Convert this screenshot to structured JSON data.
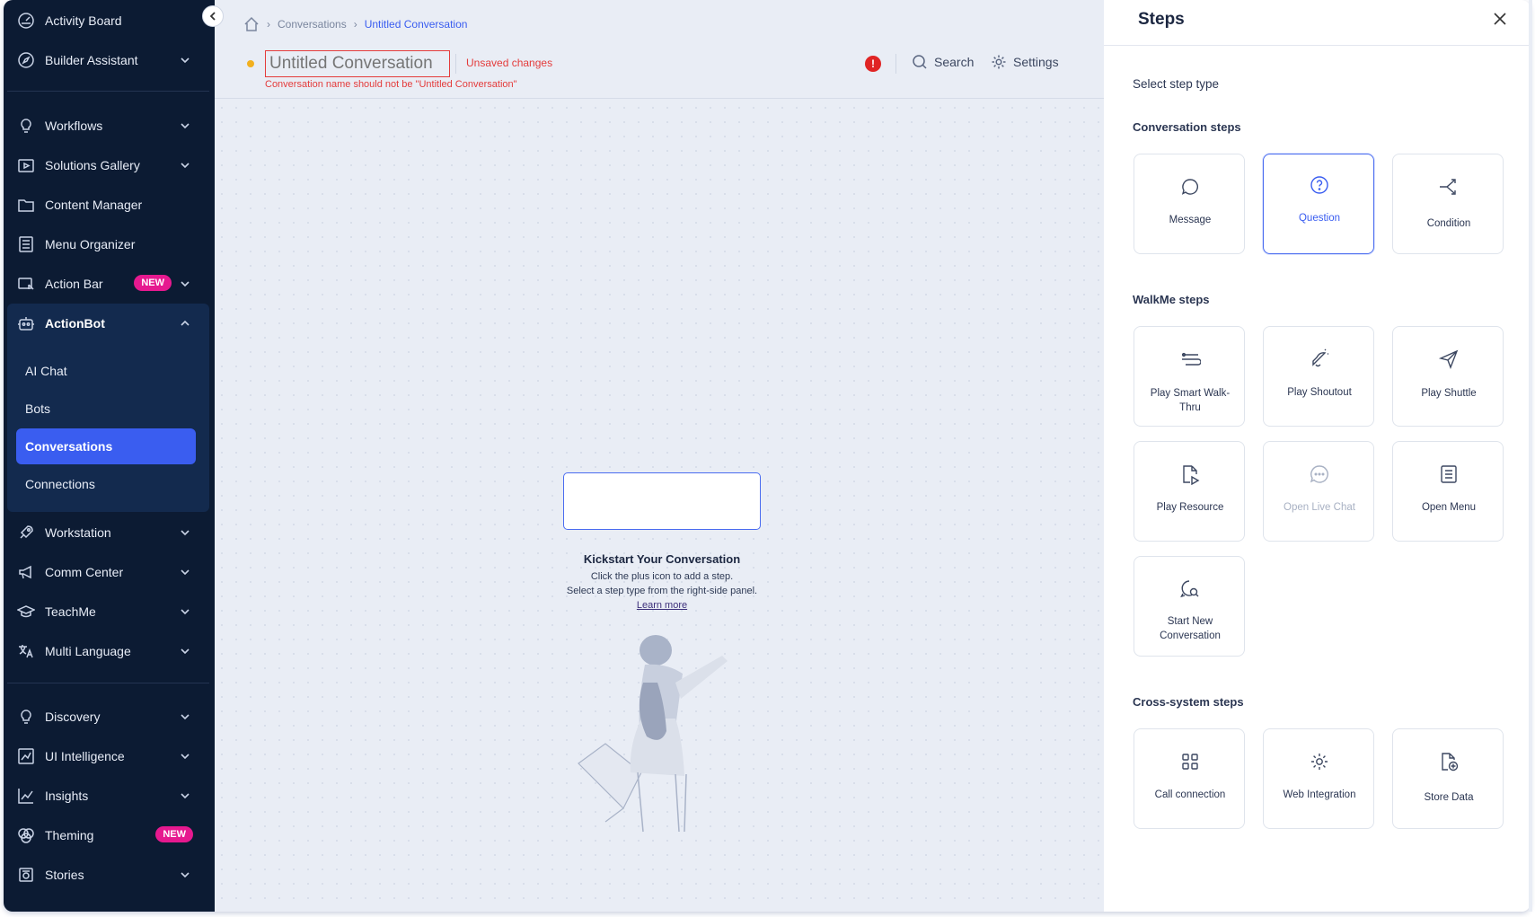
{
  "sidebar": {
    "items_top": [
      {
        "label": "Activity Board",
        "icon": "gauge-icon",
        "chevron": false
      },
      {
        "label": "Builder Assistant",
        "icon": "compass-icon",
        "chevron": true
      }
    ],
    "items_mid": [
      {
        "label": "Workflows",
        "icon": "bulb-icon",
        "chevron": true
      },
      {
        "label": "Solutions Gallery",
        "icon": "gallery-icon",
        "chevron": true
      },
      {
        "label": "Content Manager",
        "icon": "folder-icon",
        "chevron": false
      },
      {
        "label": "Menu Organizer",
        "icon": "menu-list-icon",
        "chevron": false
      },
      {
        "label": "Action Bar",
        "icon": "action-bar-icon",
        "chevron": true,
        "badge": "NEW"
      },
      {
        "label": "ActionBot",
        "icon": "robot-icon",
        "chevron": true,
        "expanded": true
      }
    ],
    "actionbot_children": [
      {
        "label": "AI Chat",
        "active": false
      },
      {
        "label": "Bots",
        "active": false
      },
      {
        "label": "Conversations",
        "active": true
      },
      {
        "label": "Connections",
        "active": false
      }
    ],
    "items_lower": [
      {
        "label": "Workstation",
        "icon": "rocket-icon",
        "chevron": true
      },
      {
        "label": "Comm Center",
        "icon": "megaphone-icon",
        "chevron": true
      },
      {
        "label": "TeachMe",
        "icon": "graduation-cap-icon",
        "chevron": true
      },
      {
        "label": "Multi Language",
        "icon": "translate-icon",
        "chevron": true
      }
    ],
    "items_bottom": [
      {
        "label": "Discovery",
        "icon": "bulb-icon",
        "chevron": true
      },
      {
        "label": "UI Intelligence",
        "icon": "ui-chart-icon",
        "chevron": true
      },
      {
        "label": "Insights",
        "icon": "line-chart-icon",
        "chevron": true
      },
      {
        "label": "Theming",
        "icon": "palette-icon",
        "chevron": false,
        "badge": "NEW"
      },
      {
        "label": "Stories",
        "icon": "stories-icon",
        "chevron": true
      }
    ]
  },
  "header": {
    "breadcrumb": [
      "Conversations",
      "Untitled Conversation"
    ],
    "title_placeholder": "Untitled Conversation",
    "unsaved": "Unsaved changes",
    "error": "Conversation name should not be \"Untitled Conversation\"",
    "error_icon": "!",
    "search": "Search",
    "settings": "Settings"
  },
  "canvas": {
    "title": "Kickstart Your Conversation",
    "line1": "Click the plus icon to add a step.",
    "line2": "Select a step type from the right-side panel.",
    "link": "Learn more"
  },
  "panel": {
    "title": "Steps",
    "select_label": "Select step type",
    "sections": [
      {
        "title": "Conversation steps",
        "cards": [
          {
            "label": "Message",
            "icon": "chat-bubble-icon",
            "state": "normal"
          },
          {
            "label": "Question",
            "icon": "question-circle-icon",
            "state": "selected"
          },
          {
            "label": "Condition",
            "icon": "branch-icon",
            "state": "normal"
          }
        ]
      },
      {
        "title": "WalkMe steps",
        "cards": [
          {
            "label": "Play Smart Walk-Thru",
            "icon": "walkthru-icon",
            "state": "normal"
          },
          {
            "label": "Play Shoutout",
            "icon": "bell-icon",
            "state": "normal"
          },
          {
            "label": "Play Shuttle",
            "icon": "send-icon",
            "state": "normal"
          },
          {
            "label": "Play Resource",
            "icon": "resource-icon",
            "state": "normal"
          },
          {
            "label": "Open Live Chat",
            "icon": "live-chat-icon",
            "state": "disabled"
          },
          {
            "label": "Open Menu",
            "icon": "menu-doc-icon",
            "state": "normal"
          },
          {
            "label": "Start New Conversation",
            "icon": "new-conversation-icon",
            "state": "normal"
          }
        ]
      },
      {
        "title": "Cross-system steps",
        "cards": [
          {
            "label": "Call connection",
            "icon": "grid-icon",
            "state": "normal"
          },
          {
            "label": "Web Integration",
            "icon": "gear-icon",
            "state": "normal"
          },
          {
            "label": "Store Data",
            "icon": "store-data-icon",
            "state": "normal"
          }
        ]
      }
    ]
  },
  "colors": {
    "sidebar_bg": "#0c1b33",
    "accent": "#3a5df0",
    "error": "#e43b3b",
    "badge": "#e6198f"
  }
}
